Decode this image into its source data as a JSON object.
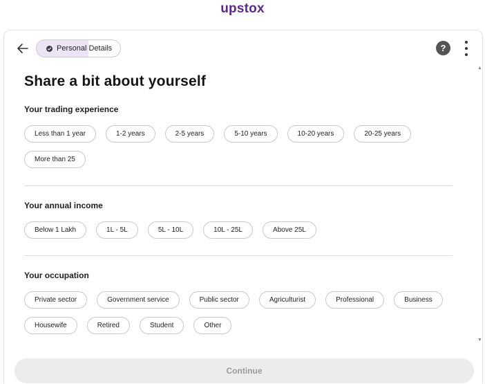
{
  "brand": {
    "logo_text": "upstox",
    "color": "#5a298b"
  },
  "header": {
    "back_icon": "arrow-left-icon",
    "step_label": "Personal Details",
    "help_label": "?",
    "more_icon": "kebab-menu-icon"
  },
  "form": {
    "title": "Share a bit about yourself",
    "experience": {
      "label": "Your trading experience",
      "options": [
        "Less than 1 year",
        "1-2 years",
        "2-5 years",
        "5-10 years",
        "10-20 years",
        "20-25 years",
        "More than 25"
      ]
    },
    "income": {
      "label": "Your annual income",
      "options": [
        "Below 1 Lakh",
        "1L - 5L",
        "5L - 10L",
        "10L - 25L",
        "Above 25L"
      ]
    },
    "occupation": {
      "label": "Your occupation",
      "options": [
        "Private sector",
        "Government service",
        "Public sector",
        "Agriculturist",
        "Professional",
        "Business",
        "Housewife",
        "Retired",
        "Student",
        "Other"
      ]
    }
  },
  "footer": {
    "continue_label": "Continue"
  }
}
